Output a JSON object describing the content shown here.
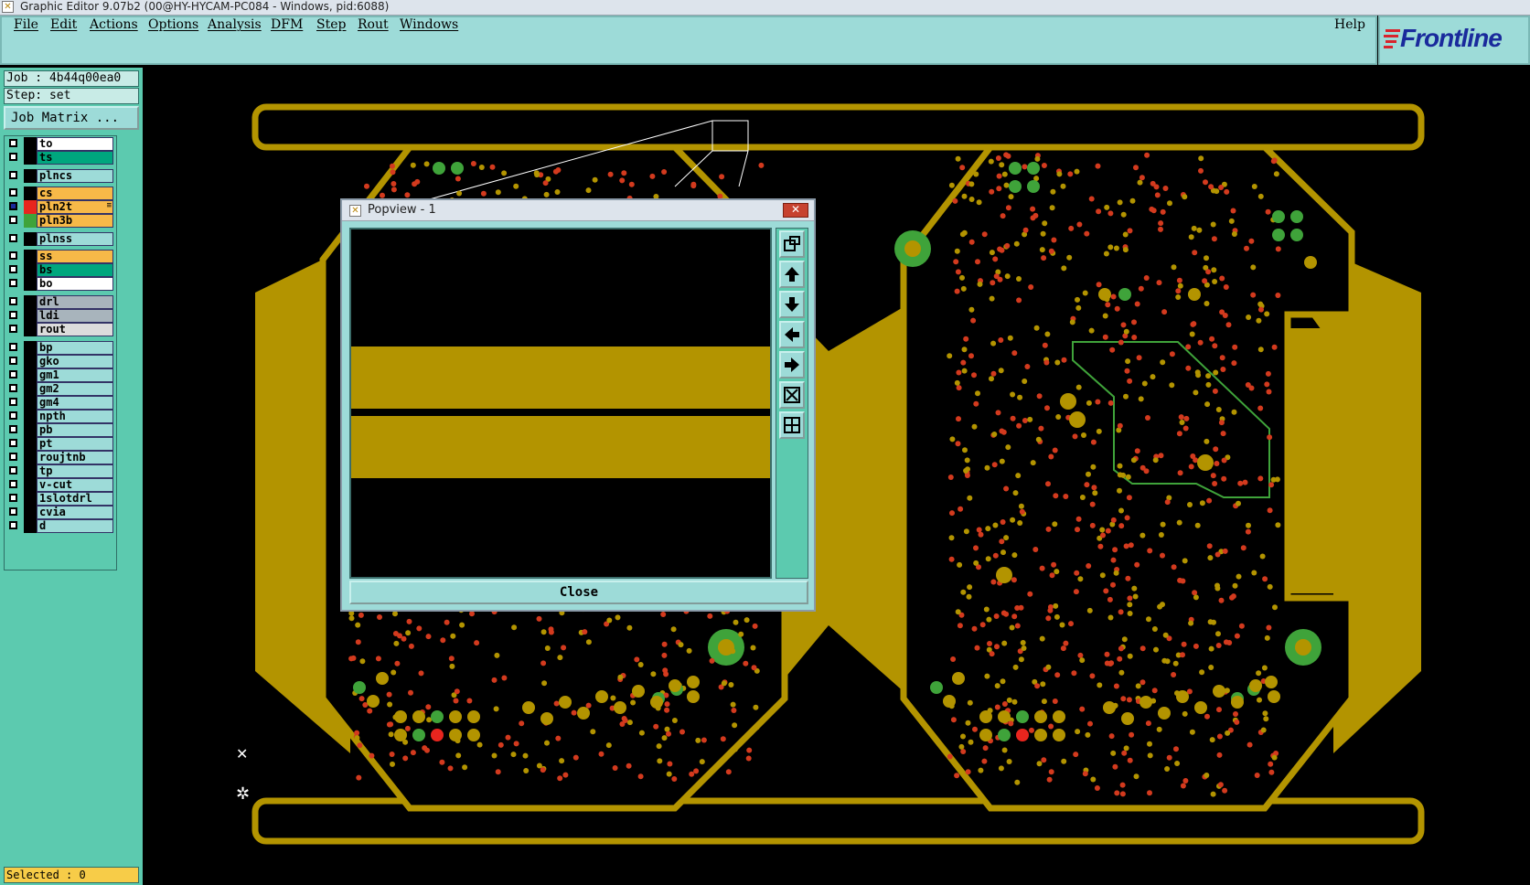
{
  "window": {
    "title": "Graphic Editor 9.07b2 (00@HY-HYCAM-PC084 - Windows, pid:6088)"
  },
  "menu": {
    "items": [
      "File",
      "Edit",
      "Actions",
      "Options",
      "Analysis",
      "DFM",
      "Step",
      "Rout",
      "Windows"
    ],
    "help": "Help"
  },
  "logo": {
    "text": "Frontline"
  },
  "job": {
    "label": "Job : 4b44q00ea0",
    "step": "Step: set"
  },
  "job_matrix_button": "Job Matrix ...",
  "layers": [
    {
      "name": "to",
      "color": "#ffffff",
      "selected": false,
      "swatch": "#000000"
    },
    {
      "name": "ts",
      "color": "#00a67e",
      "selected": false,
      "swatch": "#000000"
    },
    {
      "name": "plncs",
      "color": "#9ddbd8",
      "selected": false,
      "swatch": "#000000"
    },
    {
      "name": "cs",
      "color": "#f7b948",
      "selected": false,
      "swatch": "#000000"
    },
    {
      "name": "pln2t",
      "color": "#f7b948",
      "selected": true,
      "swatch": "#e8251e",
      "mark": "≡"
    },
    {
      "name": "pln3b",
      "color": "#f7b948",
      "selected": false,
      "swatch": "#3fa33a"
    },
    {
      "name": "plnss",
      "color": "#9ddbd8",
      "selected": false,
      "swatch": "#000000"
    },
    {
      "name": "ss",
      "color": "#f7b948",
      "selected": false,
      "swatch": "#000000"
    },
    {
      "name": "bs",
      "color": "#00a67e",
      "selected": false,
      "swatch": "#000000"
    },
    {
      "name": "bo",
      "color": "#ffffff",
      "selected": false,
      "swatch": "#000000"
    },
    {
      "name": "drl",
      "color": "#a8b4bc",
      "selected": false,
      "swatch": "#000000"
    },
    {
      "name": "ldi",
      "color": "#a8b4bc",
      "selected": false,
      "swatch": "#000000"
    },
    {
      "name": "rout",
      "color": "#dcdcdc",
      "selected": false,
      "swatch": "#000000"
    },
    {
      "name": "bp",
      "color": "#9ddbd8",
      "selected": false,
      "swatch": "#000000"
    },
    {
      "name": "gko",
      "color": "#9ddbd8",
      "selected": false,
      "swatch": "#000000"
    },
    {
      "name": "gm1",
      "color": "#9ddbd8",
      "selected": false,
      "swatch": "#000000"
    },
    {
      "name": "gm2",
      "color": "#9ddbd8",
      "selected": false,
      "swatch": "#000000"
    },
    {
      "name": "gm4",
      "color": "#9ddbd8",
      "selected": false,
      "swatch": "#000000"
    },
    {
      "name": "npth",
      "color": "#9ddbd8",
      "selected": false,
      "swatch": "#000000"
    },
    {
      "name": "pb",
      "color": "#9ddbd8",
      "selected": false,
      "swatch": "#000000"
    },
    {
      "name": "pt",
      "color": "#9ddbd8",
      "selected": false,
      "swatch": "#000000"
    },
    {
      "name": "roujtnb",
      "color": "#9ddbd8",
      "selected": false,
      "swatch": "#000000"
    },
    {
      "name": "tp",
      "color": "#9ddbd8",
      "selected": false,
      "swatch": "#000000"
    },
    {
      "name": "v-cut",
      "color": "#9ddbd8",
      "selected": false,
      "swatch": "#000000"
    },
    {
      "name": "1slotdrl",
      "color": "#9ddbd8",
      "selected": false,
      "swatch": "#000000"
    },
    {
      "name": "cvia",
      "color": "#9ddbd8",
      "selected": false,
      "swatch": "#000000"
    },
    {
      "name": "d",
      "color": "#9ddbd8",
      "selected": false,
      "swatch": "#000000"
    }
  ],
  "status": {
    "selected": "Selected : 0"
  },
  "popview": {
    "title": "Popview - 1",
    "close_x": "✕",
    "close_button": "Close",
    "tools": [
      "zoom-window-icon",
      "pan-up-icon",
      "pan-down-icon",
      "pan-left-icon",
      "pan-right-icon",
      "zoom-fit-icon",
      "zoom-center-icon"
    ]
  },
  "colors": {
    "copper": "#b39400",
    "pad_green": "#3fa33a",
    "pad_red": "#e8251e",
    "panel_teal": "#9ddbd8",
    "sidebar_green": "#5ccaaf"
  }
}
